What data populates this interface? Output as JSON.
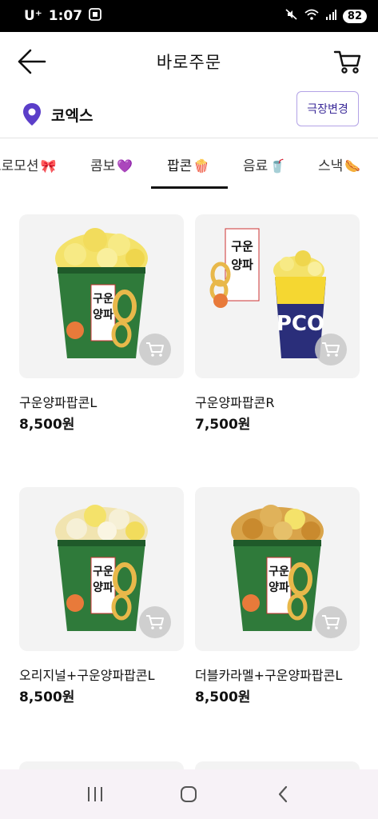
{
  "status_bar": {
    "carrier": "U⁺",
    "time": "1:07",
    "battery": "82"
  },
  "header": {
    "title": "바로주문"
  },
  "location": {
    "name": "코엑스",
    "change_button": "극장변경"
  },
  "tabs": [
    {
      "label": "프로모션",
      "emoji": "🎀"
    },
    {
      "label": "콤보",
      "emoji": "💜"
    },
    {
      "label": "팝콘",
      "emoji": "🍿",
      "active": true
    },
    {
      "label": "음료",
      "emoji": "🥤"
    },
    {
      "label": "스낵",
      "emoji": "🌭"
    }
  ],
  "products": [
    {
      "name": "구운양파팝콘L",
      "price": "8,500원"
    },
    {
      "name": "구운양파팝콘R",
      "price": "7,500원"
    },
    {
      "name": "오리지널+구운양파팝콘L",
      "price": "8,500원"
    },
    {
      "name": "더블카라멜+구운양파팝콘L",
      "price": "8,500원"
    }
  ],
  "product_art": {
    "cup_label": "구운양파",
    "r_cup_text": "PCO"
  },
  "colors": {
    "accent_purple": "#5b3ec9",
    "cup_green": "#2f7a3a",
    "cup_navy": "#2a2e7a",
    "popcorn_yellow": "#f4e26a"
  }
}
